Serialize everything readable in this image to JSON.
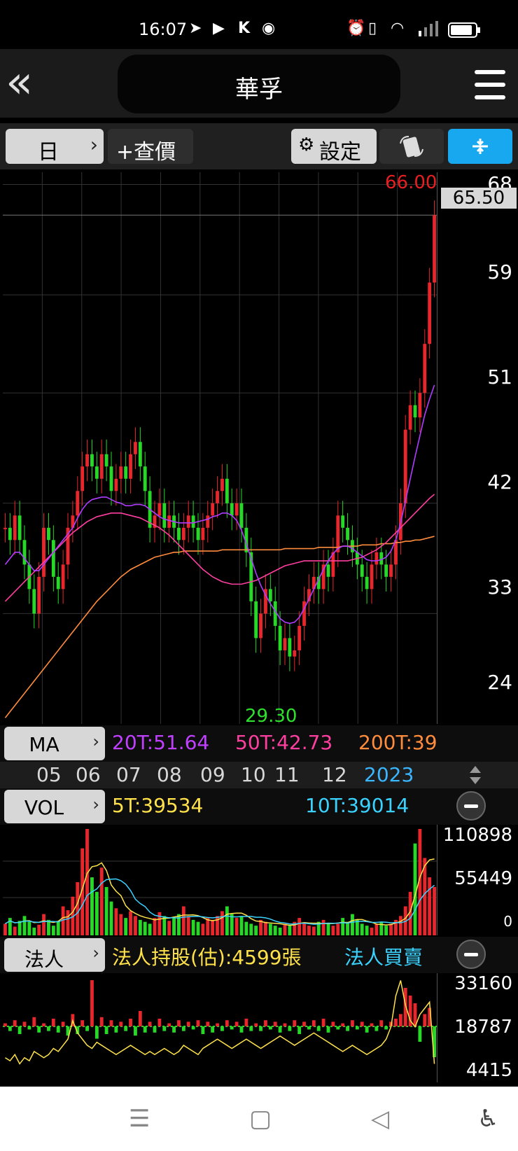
{
  "status": {
    "time": "16:07"
  },
  "header": {
    "title": "華孚"
  },
  "toolbar": {
    "period_label": "日",
    "query_label": "+查價",
    "settings_label": "設定"
  },
  "chart_data": {
    "type": "candlestick",
    "y_ticks": [
      "68",
      "59",
      "51",
      "42",
      "33",
      "24"
    ],
    "current_price": "65.50",
    "high_label": "66.00",
    "low_label": "29.30",
    "x_ticks": [
      "05",
      "06",
      "07",
      "08",
      "09",
      "10",
      "11",
      "12",
      "2023"
    ],
    "ylim": [
      24,
      69
    ],
    "close": [
      40,
      39,
      41,
      39,
      37,
      35,
      33,
      36,
      40,
      39,
      36,
      35,
      37,
      40,
      41,
      43,
      45,
      46,
      45,
      44,
      46,
      45,
      43,
      44,
      45,
      44,
      46,
      47,
      45,
      43,
      40,
      41,
      42,
      40,
      41,
      40,
      39,
      40,
      41,
      40,
      39,
      40,
      41,
      42,
      43,
      44,
      42,
      41,
      42,
      40,
      38,
      34,
      31,
      33,
      35,
      34,
      32,
      30,
      31,
      29.5,
      30,
      32,
      34,
      35,
      36,
      35,
      37,
      36,
      38,
      41,
      40,
      39,
      38,
      37,
      36,
      35,
      37,
      38,
      37,
      36,
      37,
      39,
      42,
      48,
      50,
      49,
      51,
      55,
      60,
      65.5
    ],
    "ma20": [
      37,
      37.5,
      38,
      38,
      37.5,
      37,
      36.5,
      36.5,
      37,
      37.5,
      38,
      38.5,
      39,
      39.5,
      40,
      40.8,
      41.5,
      42,
      42.3,
      42.4,
      42.5,
      42.5,
      42.3,
      42.1,
      42,
      41.8,
      41.8,
      41.9,
      41.9,
      41.8,
      41.5,
      41.2,
      40.9,
      40.7,
      40.6,
      40.5,
      40.4,
      40.4,
      40.4,
      40.4,
      40.5,
      40.6,
      40.7,
      40.9,
      41,
      41.2,
      41.2,
      41,
      40.6,
      39.8,
      38.7,
      37.5,
      36.3,
      35.3,
      34.5,
      33.8,
      33.2,
      32.6,
      32.3,
      32.2,
      32.3,
      32.7,
      33.4,
      34.2,
      35,
      35.8,
      36.6,
      37.3,
      37.9,
      38.3,
      38.5,
      38.5,
      38.3,
      38,
      37.7,
      37.4,
      37.3,
      37.3,
      37.4,
      37.6,
      38.1,
      39,
      40.4,
      42.2,
      44,
      45.8,
      47.5,
      49.2,
      50.5,
      51.64
    ],
    "ma50": [
      34,
      34.4,
      34.8,
      35.2,
      35.6,
      36,
      36.4,
      36.8,
      37.2,
      37.6,
      38,
      38.4,
      38.8,
      39.2,
      39.6,
      39.9,
      40.2,
      40.5,
      40.7,
      40.9,
      41,
      41.1,
      41.2,
      41.2,
      41.2,
      41.1,
      41,
      40.9,
      40.8,
      40.6,
      40.4,
      40.2,
      40,
      39.7,
      39.4,
      39,
      38.6,
      38.2,
      37.8,
      37.4,
      37,
      36.6,
      36.3,
      36,
      35.8,
      35.6,
      35.5,
      35.4,
      35.4,
      35.4,
      35.5,
      35.6,
      35.7,
      35.9,
      36.1,
      36.3,
      36.5,
      36.7,
      36.9,
      37,
      37.1,
      37.2,
      37.3,
      37.3,
      37.3,
      37.3,
      37.3,
      37.3,
      37.3,
      37.3,
      37.3,
      37.3,
      37.4,
      37.5,
      37.6,
      37.8,
      38,
      38.2,
      38.5,
      38.8,
      39.2,
      39.6,
      40,
      40.4,
      40.8,
      41.2,
      41.6,
      42,
      42.4,
      42.73
    ],
    "ma200": [
      24.5,
      25,
      25.5,
      26,
      26.5,
      27,
      27.5,
      28,
      28.5,
      29,
      29.5,
      30,
      30.5,
      31,
      31.5,
      32,
      32.5,
      33,
      33.5,
      34,
      34.4,
      34.8,
      35.2,
      35.6,
      36,
      36.3,
      36.6,
      36.8,
      37,
      37.2,
      37.4,
      37.6,
      37.7,
      37.8,
      37.9,
      38,
      38,
      38.1,
      38.1,
      38.1,
      38.1,
      38.1,
      38.1,
      38.1,
      38.1,
      38.2,
      38.2,
      38.2,
      38.2,
      38.2,
      38.2,
      38.2,
      38.2,
      38.2,
      38.2,
      38.2,
      38.2,
      38.2,
      38.3,
      38.3,
      38.3,
      38.3,
      38.3,
      38.3,
      38.3,
      38.4,
      38.4,
      38.4,
      38.4,
      38.4,
      38.5,
      38.5,
      38.5,
      38.5,
      38.6,
      38.6,
      38.6,
      38.6,
      38.7,
      38.7,
      38.7,
      38.8,
      38.8,
      38.9,
      38.9,
      39,
      39,
      39.1,
      39.2,
      39.3
    ],
    "ma_labels": [
      "20T:51.64",
      "50T:42.73",
      "200T:39"
    ],
    "volume": {
      "ticks": [
        "110898",
        "55449",
        "0"
      ],
      "ma_labels": [
        "5T:39534",
        "10T:39014"
      ],
      "values": [
        12,
        18,
        9,
        15,
        20,
        14,
        8,
        11,
        22,
        16,
        10,
        14,
        30,
        26,
        40,
        55,
        90,
        110,
        60,
        45,
        70,
        50,
        35,
        28,
        22,
        18,
        25,
        20,
        16,
        14,
        12,
        18,
        24,
        20,
        15,
        18,
        22,
        30,
        20,
        16,
        14,
        12,
        18,
        16,
        20,
        25,
        30,
        22,
        18,
        20,
        14,
        12,
        10,
        16,
        14,
        12,
        10,
        8,
        12,
        10,
        14,
        18,
        12,
        10,
        9,
        14,
        16,
        12,
        10,
        12,
        18,
        14,
        22,
        16,
        12,
        10,
        8,
        12,
        14,
        10,
        12,
        16,
        20,
        30,
        45,
        95,
        110,
        80,
        60,
        50
      ]
    },
    "institutional": {
      "ticks": [
        "33160",
        "18787",
        "4415"
      ],
      "label1": "法人持股(估):4599張",
      "label2": "法人買賣",
      "net": [
        2,
        -3,
        4,
        -5,
        3,
        -2,
        6,
        -4,
        2,
        -3,
        5,
        -4,
        3,
        -6,
        8,
        -5,
        4,
        -3,
        30,
        -8,
        6,
        -5,
        4,
        -4,
        3,
        -3,
        5,
        -6,
        10,
        -4,
        3,
        -4,
        5,
        -3,
        2,
        -4,
        4,
        -3,
        3,
        -2,
        4,
        -5,
        3,
        -4,
        2,
        -3,
        4,
        -2,
        3,
        -4,
        5,
        -3,
        2,
        -3,
        4,
        -2,
        3,
        -4,
        2,
        -3,
        4,
        -5,
        3,
        -2,
        4,
        -3,
        5,
        -4,
        3,
        -2,
        2,
        -3,
        4,
        -2,
        3,
        -4,
        2,
        -3,
        4,
        -2,
        3,
        5,
        8,
        25,
        20,
        15,
        -10,
        8,
        12,
        -20
      ],
      "holding": [
        8,
        7,
        9,
        6,
        8,
        7,
        10,
        9,
        8,
        9,
        11,
        10,
        12,
        14,
        20,
        16,
        14,
        12,
        11,
        13,
        12,
        11,
        10,
        9,
        10,
        11,
        12,
        11,
        10,
        9,
        10,
        9,
        10,
        11,
        10,
        9,
        10,
        12,
        11,
        10,
        9,
        11,
        12,
        13,
        14,
        13,
        12,
        11,
        12,
        13,
        14,
        13,
        12,
        11,
        12,
        13,
        14,
        15,
        14,
        13,
        12,
        13,
        14,
        15,
        16,
        15,
        14,
        13,
        12,
        11,
        10,
        11,
        12,
        11,
        10,
        9,
        10,
        11,
        12,
        14,
        18,
        28,
        33,
        25,
        20,
        18,
        22,
        24,
        26,
        6
      ]
    }
  }
}
